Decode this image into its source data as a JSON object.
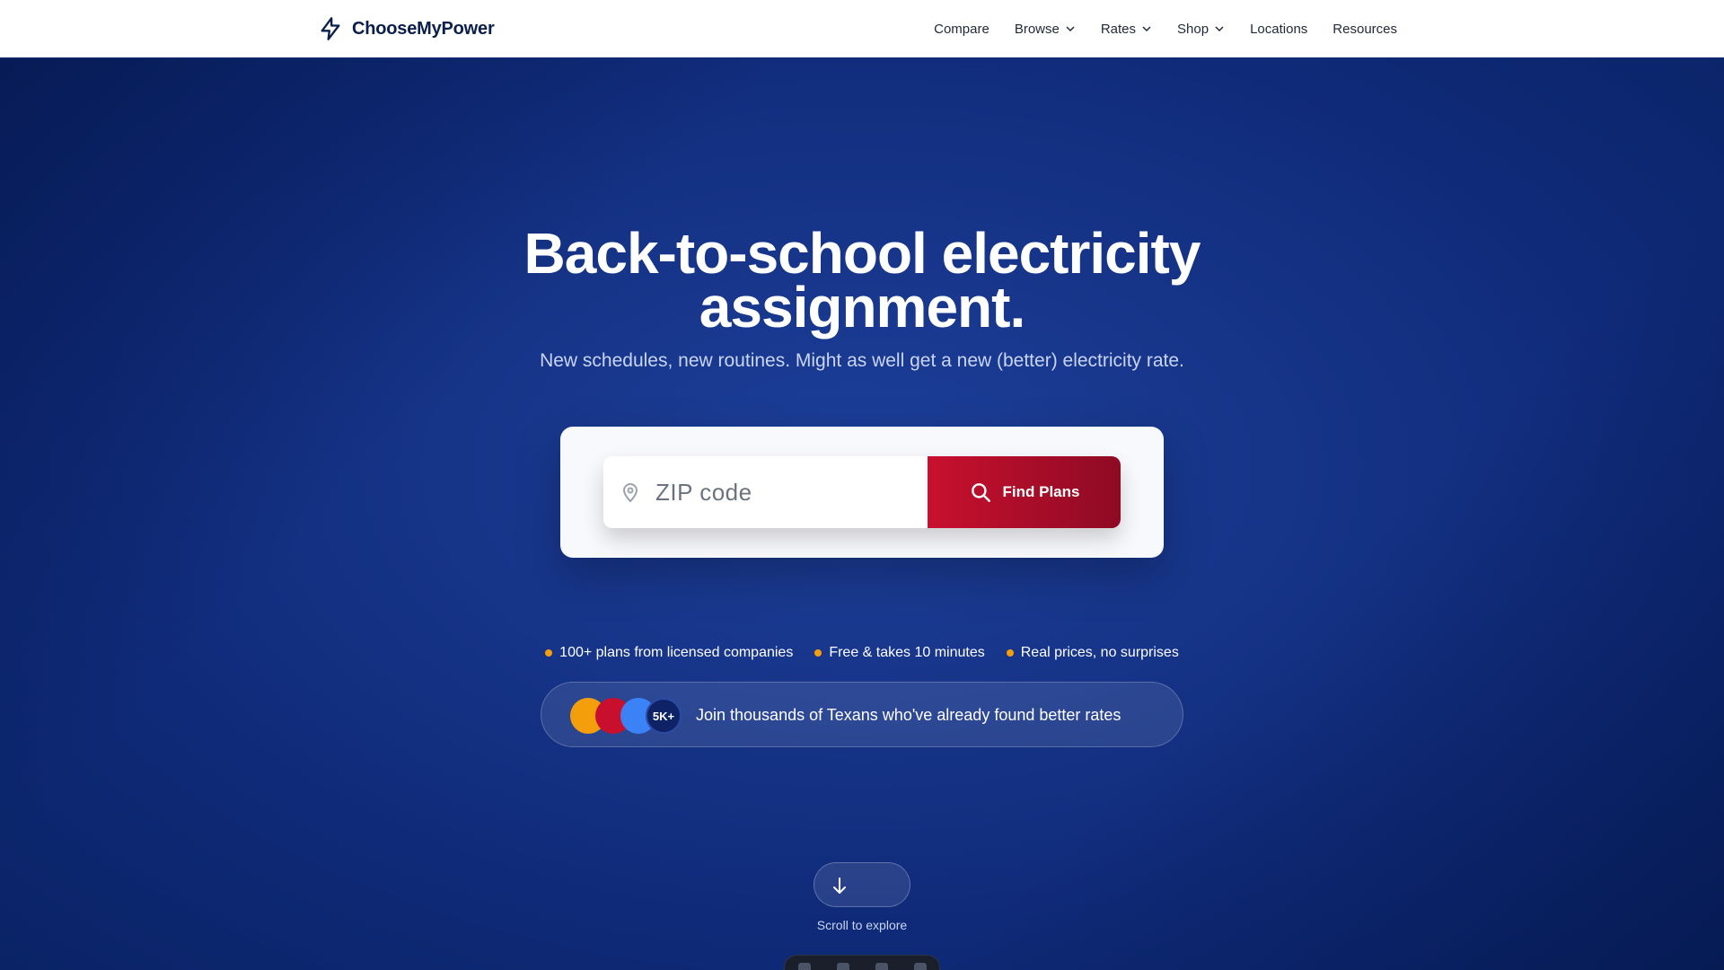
{
  "brand": {
    "name": "ChooseMyPower",
    "icon": "lightning-bolt-icon"
  },
  "nav": {
    "items": [
      {
        "label": "Compare",
        "dropdown": false
      },
      {
        "label": "Browse",
        "dropdown": true
      },
      {
        "label": "Rates",
        "dropdown": true
      },
      {
        "label": "Shop",
        "dropdown": true
      },
      {
        "label": "Locations",
        "dropdown": false
      },
      {
        "label": "Resources",
        "dropdown": false
      }
    ]
  },
  "hero": {
    "headline_line1": "Back-to-school electricity",
    "headline_line2": "assignment.",
    "subhead": "New schedules, new routines. Might as well get a new (better) electricity rate."
  },
  "search": {
    "zip_placeholder": "ZIP code",
    "zip_value": "",
    "button_label": "Find Plans"
  },
  "features": [
    "100+ plans from licensed companies",
    "Free & takes 10 minutes",
    "Real prices, no surprises"
  ],
  "social_proof": {
    "badge": "5K+",
    "text": "Join thousands of Texans who've already found better rates"
  },
  "scroll": {
    "label": "Scroll to explore"
  },
  "colors": {
    "brand_navy": "#0b1f4b",
    "hero_blue": "#163488",
    "accent_red": "#c8102e",
    "accent_orange": "#f59e0b",
    "accent_blue": "#3b82f6"
  }
}
